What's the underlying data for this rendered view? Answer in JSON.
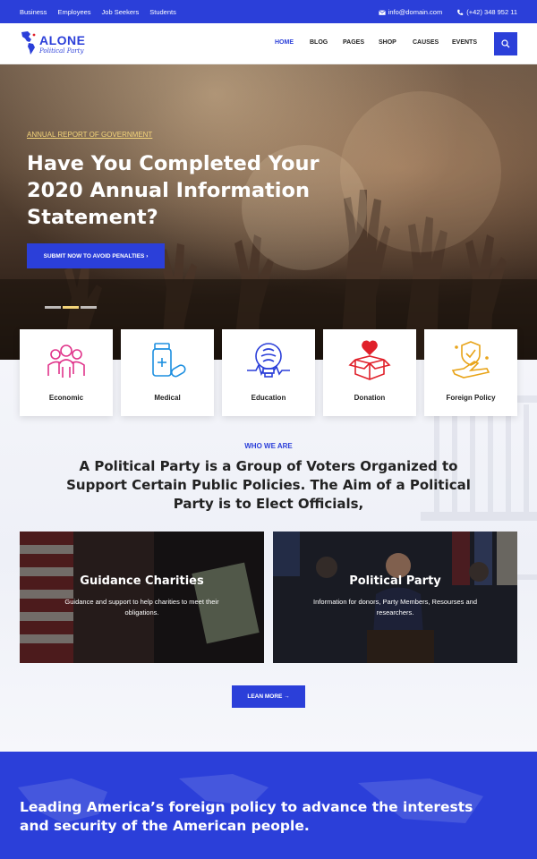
{
  "topbar": {
    "links": [
      "Business",
      "Employees",
      "Job Seekers",
      "Students"
    ],
    "email": "info@domain.com",
    "phone": "(+42) 348 952 11"
  },
  "logo": {
    "name": "ALONE",
    "tagline": "Political Party"
  },
  "nav": {
    "items": [
      "HOME",
      "BLOG",
      "PAGES",
      "SHOP",
      "CAUSES",
      "EVENTS"
    ],
    "active": "HOME"
  },
  "hero": {
    "kicker": "ANNUAL REPORT OF GOVERNMENT",
    "title": "Have You Completed Your 2020 Annual Information Statement?",
    "cta": "SUBMIT NOW TO AVOID PENALTIES ›",
    "active_slide": 2,
    "slide_count": 3
  },
  "cards": [
    {
      "label": "Economic",
      "icon": "people-icon",
      "color": "#e0338a"
    },
    {
      "label": "Medical",
      "icon": "medicine-icon",
      "color": "#1d8fe0"
    },
    {
      "label": "Education",
      "icon": "lightbulb-brain-icon",
      "color": "#2b3fd9"
    },
    {
      "label": "Donation",
      "icon": "donation-box-icon",
      "color": "#e0202a"
    },
    {
      "label": "Foreign Policy",
      "icon": "plane-shield-icon",
      "color": "#e8a317"
    }
  ],
  "who": {
    "kicker": "WHO WE ARE",
    "title": "A Political Party is a Group of Voters Organized to Support Certain Public Policies. The Aim of a Political Party is to Elect Officials,"
  },
  "features": [
    {
      "title": "Guidance Charities",
      "description": "Guidance and support to help charities to meet their obligations."
    },
    {
      "title": "Political Party",
      "description": "Information for donors, Party Members, Resourses and researchers."
    }
  ],
  "learn_more": "LEAN MORE →",
  "bottom": {
    "title": "Leading America’s foreign policy to advance the interests and security of the American people."
  },
  "colors": {
    "primary": "#2b3fd9",
    "accent": "#f3d47a"
  }
}
